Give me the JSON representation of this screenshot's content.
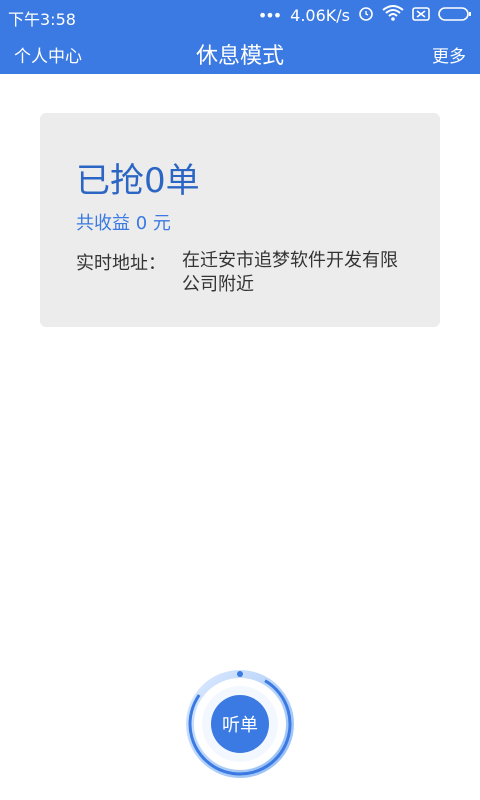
{
  "status_bar": {
    "time": "下午3:58",
    "network_speed": "4.06K/s",
    "icons": [
      "dots-icon",
      "alarm-icon",
      "wifi-icon",
      "sim-icon",
      "battery-icon"
    ]
  },
  "header": {
    "left_label": "个人中心",
    "title": "休息模式",
    "right_label": "更多"
  },
  "card": {
    "orders_text": "已抢0单",
    "earnings_text": "共收益 0 元",
    "address_label": "实时地址：",
    "address_value": "在迁安市追梦软件开发有限公司附近"
  },
  "listen_button": {
    "label": "听单"
  },
  "colors": {
    "primary": "#3a7ae2",
    "card_bg": "#ececec",
    "text_dark": "#333333"
  }
}
